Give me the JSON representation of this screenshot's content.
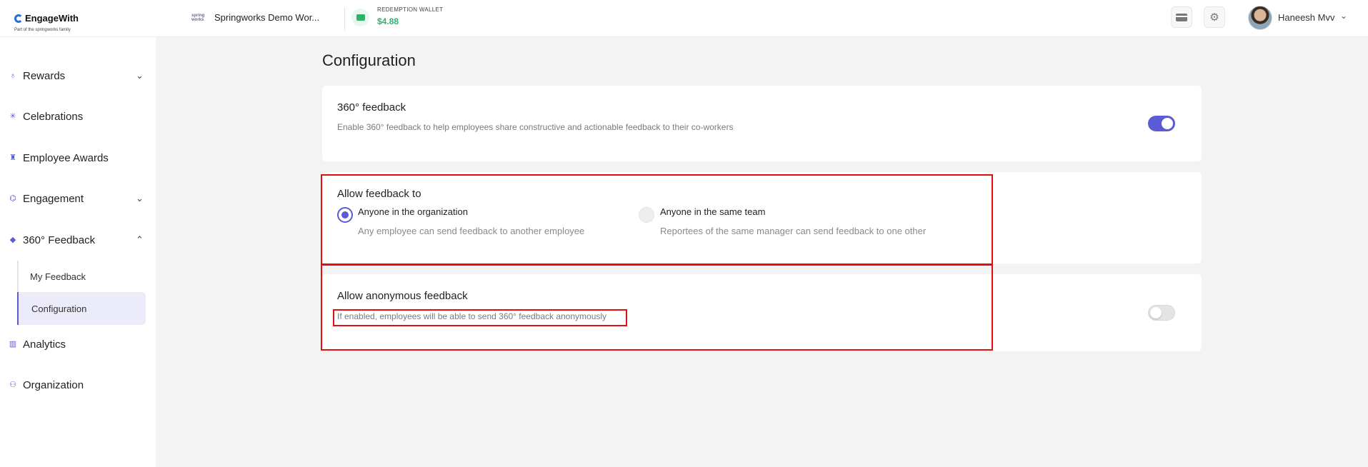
{
  "header": {
    "brand": "EngageWith",
    "brand_tagline": "Part of the springworks family",
    "workspace_logo_text": "spring works",
    "workspace_name": "Springworks Demo Wor...",
    "wallet_label": "REDEMPTION WALLET",
    "wallet_amount": "$4.88",
    "user_name": "Haneesh Mvv"
  },
  "sidebar": {
    "items": [
      {
        "label": "Rewards",
        "icon": "medal-icon",
        "chevron": "⌄"
      },
      {
        "label": "Celebrations",
        "icon": "party-icon"
      },
      {
        "label": "Employee Awards",
        "icon": "trophy-icon"
      },
      {
        "label": "Engagement",
        "icon": "engagement-icon",
        "chevron": "⌄"
      },
      {
        "label": "360° Feedback",
        "icon": "feedback-icon",
        "chevron": "⌃"
      },
      {
        "label": "Analytics",
        "icon": "analytics-icon"
      },
      {
        "label": "Organization",
        "icon": "organization-icon"
      }
    ],
    "subitems": [
      {
        "label": "My Feedback"
      },
      {
        "label": "Configuration",
        "active": true
      }
    ]
  },
  "main": {
    "title": "Configuration",
    "card1": {
      "title": "360° feedback",
      "desc": "Enable 360° feedback to help employees share constructive and actionable feedback to their co-workers",
      "toggle_on": true
    },
    "card2": {
      "title": "Allow feedback to",
      "options": [
        {
          "label": "Anyone in the organization",
          "desc": "Any employee can send feedback to another employee",
          "checked": true
        },
        {
          "label": "Anyone in the same team",
          "desc": "Reportees of the same manager can send feedback to one other",
          "checked": false
        }
      ]
    },
    "card3": {
      "title": "Allow anonymous feedback",
      "desc": "If enabled, employees will be able to send 360° feedback anonymously",
      "toggle_on": false
    }
  },
  "colors": {
    "accent": "#5b5bd6",
    "wallet": "#2fb26a",
    "highlight": "#e01010"
  }
}
